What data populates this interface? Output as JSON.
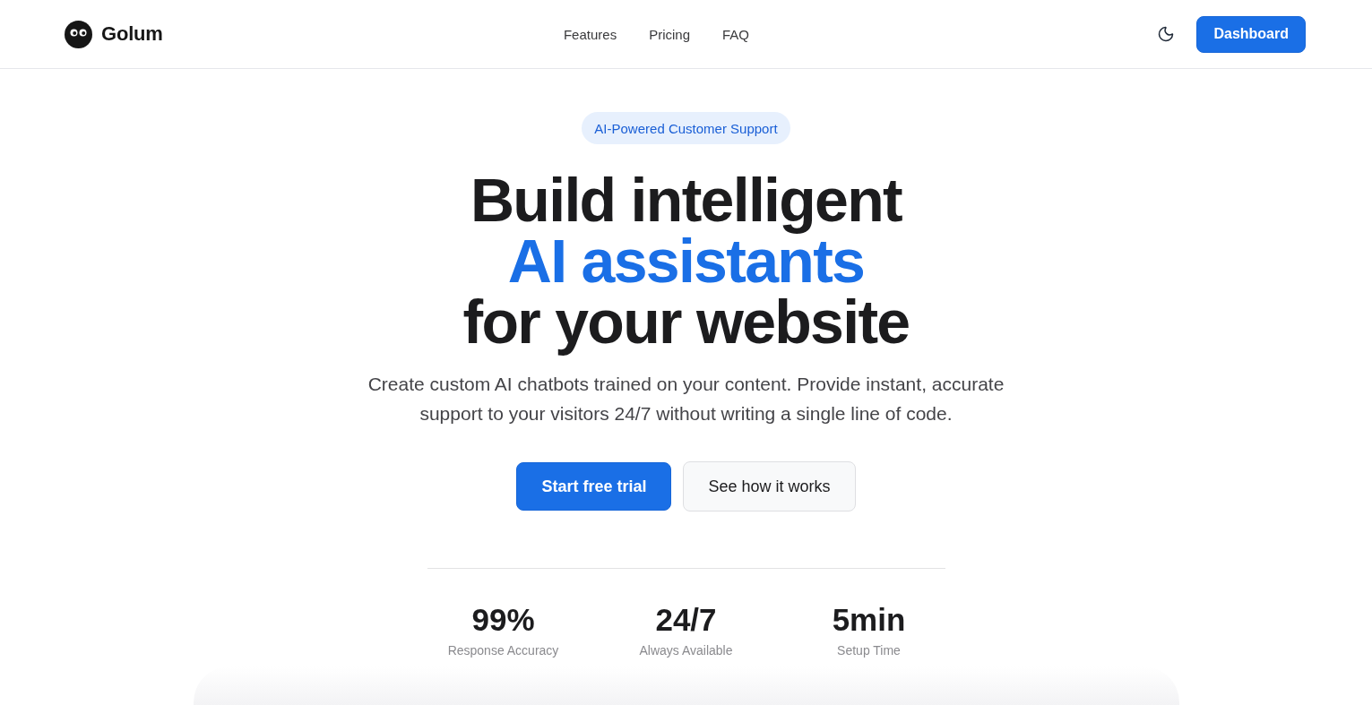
{
  "nav": {
    "brand": "Golum",
    "links": [
      {
        "label": "Features"
      },
      {
        "label": "Pricing"
      },
      {
        "label": "FAQ"
      }
    ],
    "cta": "Dashboard"
  },
  "hero": {
    "badge": "AI-Powered Customer Support",
    "heading": [
      {
        "text": "Build intelligent",
        "accent": false
      },
      {
        "text": "AI assistants",
        "accent": true
      },
      {
        "text": "for your website",
        "accent": false
      }
    ],
    "subtitle": "Create custom AI chatbots trained on your content. Provide instant, accurate support to your visitors 24/7 without writing a single line of code.",
    "buttons": [
      {
        "label": "Start free trial",
        "kind": "primary"
      },
      {
        "label": "See how it works",
        "kind": "secondary"
      }
    ]
  },
  "stats": [
    {
      "value": "99%",
      "label": "Response Accuracy"
    },
    {
      "value": "24/7",
      "label": "Always Available"
    },
    {
      "value": "5min",
      "label": "Setup Time"
    }
  ]
}
